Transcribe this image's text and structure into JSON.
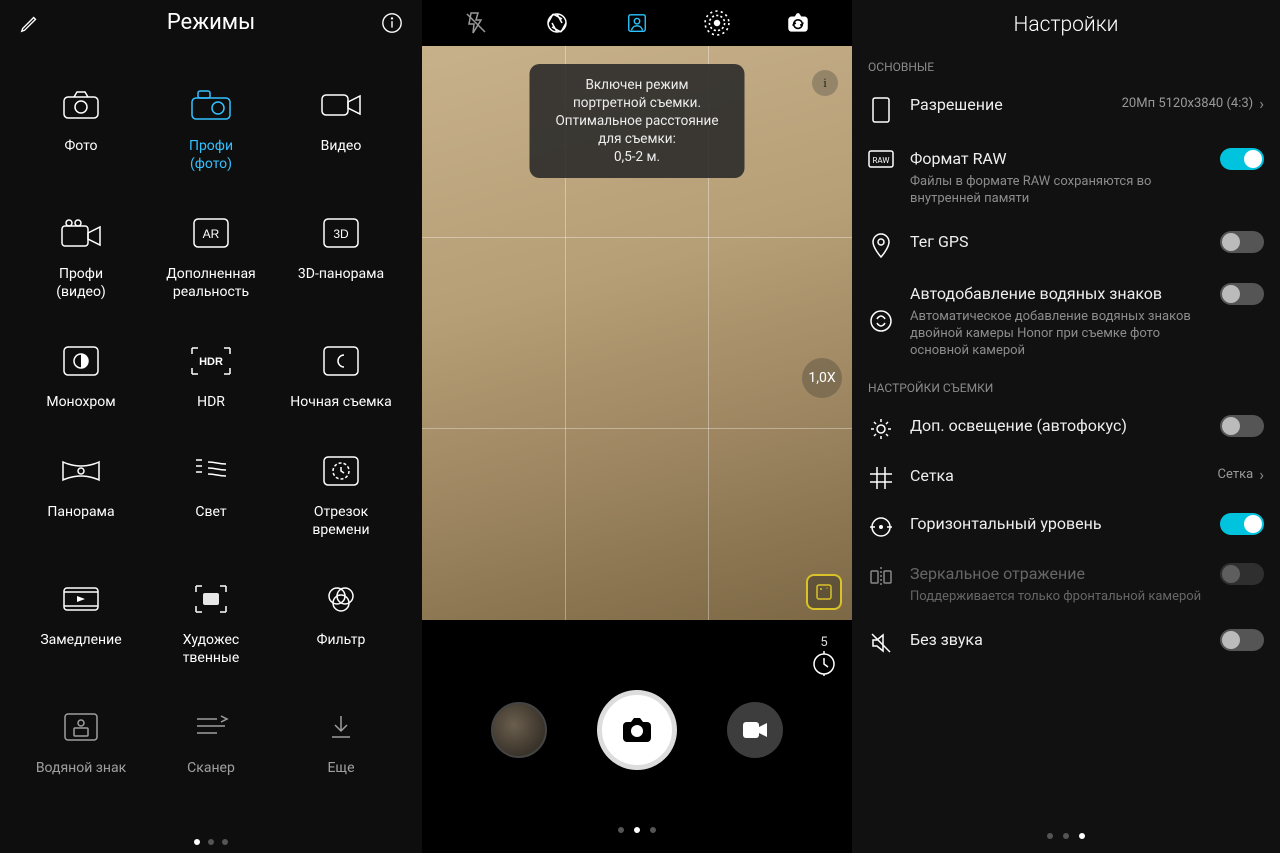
{
  "left": {
    "title": "Режимы",
    "modes": [
      {
        "label": "Фото"
      },
      {
        "label": "Профи\n(фото)"
      },
      {
        "label": "Видео"
      },
      {
        "label": "Профи\n(видео)"
      },
      {
        "label": "Дополненная\nреальность"
      },
      {
        "label": "3D-панорама"
      },
      {
        "label": "Монохром"
      },
      {
        "label": "HDR"
      },
      {
        "label": "Ночная съемка"
      },
      {
        "label": "Панорама"
      },
      {
        "label": "Свет"
      },
      {
        "label": "Отрезок\nвремени"
      },
      {
        "label": "Замедление"
      },
      {
        "label": "Художес\nтвенные"
      },
      {
        "label": "Фильтр"
      },
      {
        "label": "Водяной знак"
      },
      {
        "label": "Сканер"
      },
      {
        "label": "Еще"
      }
    ]
  },
  "mid": {
    "toast": "Включен режим портретной съемки.\nОптимальное расстояние для съемки:\n0,5-2 м.",
    "info_symbol": "i",
    "zoom": "1,0X",
    "timer": "5"
  },
  "right": {
    "title": "Настройки",
    "section1": "ОСНОВНЫЕ",
    "section2": "НАСТРОЙКИ СЪЕМКИ",
    "rows": {
      "resolution": {
        "title": "Разрешение",
        "value": "20Мп 5120x3840 (4:3)"
      },
      "raw": {
        "title": "Формат RAW",
        "sub": "Файлы в формате RAW сохраняются во внутренней памяти"
      },
      "gps": {
        "title": "Тег GPS"
      },
      "watermark": {
        "title": "Автодобавление водяных знаков",
        "sub": "Автоматическое добавление водяных знаков двойной камеры Honor при съемке фото основной камерой"
      },
      "light": {
        "title": "Доп. освещение (автофокус)"
      },
      "grid": {
        "title": "Сетка",
        "value": "Сетка"
      },
      "level": {
        "title": "Горизонтальный уровень"
      },
      "mirror": {
        "title": "Зеркальное отражение",
        "sub": "Поддерживается только фронтальной камерой"
      },
      "mute": {
        "title": "Без звука"
      }
    }
  }
}
